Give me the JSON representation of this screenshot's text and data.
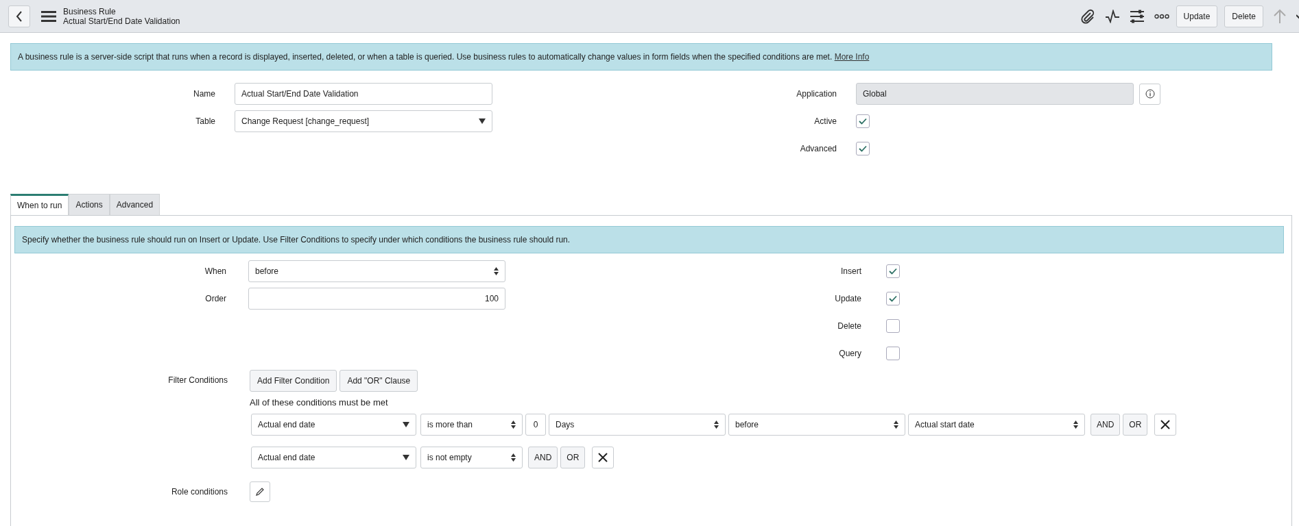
{
  "header": {
    "title": "Business Rule",
    "subtitle": "Actual Start/End Date Validation",
    "buttons": [
      "Update",
      "Delete"
    ]
  },
  "info_banner": {
    "text": "A business rule is a server-side script that runs when a record is displayed, inserted, deleted, or when a table is queried. Use business rules to automatically change values in form fields when the specified conditions are met.",
    "link": "More Info"
  },
  "fields_left": [
    {
      "label": "Name",
      "kind": "text",
      "value": "Actual Start/End Date Validation"
    },
    {
      "label": "Table",
      "kind": "select",
      "value": "Change Request [change_request]"
    }
  ],
  "fields_right": [
    {
      "label": "Application",
      "kind": "readonly",
      "value": "Global"
    },
    {
      "label": "Active",
      "kind": "checkbox",
      "checked": true
    },
    {
      "label": "Advanced",
      "kind": "checkbox",
      "checked": true
    }
  ],
  "tabs": [
    {
      "label": "When to run",
      "selected": true
    },
    {
      "label": "Actions",
      "selected": false
    },
    {
      "label": "Advanced",
      "selected": false
    }
  ],
  "tab_banner": "Specify whether the business rule should run on Insert or Update. Use Filter Conditions to specify under which conditions the business rule should run.",
  "when_fields": [
    {
      "label": "When",
      "kind": "select",
      "value": "before"
    },
    {
      "label": "Order",
      "kind": "number",
      "value": "100"
    }
  ],
  "operations": [
    {
      "label": "Insert",
      "checked": true
    },
    {
      "label": "Update",
      "checked": true
    },
    {
      "label": "Delete",
      "checked": false
    },
    {
      "label": "Query",
      "checked": false
    }
  ],
  "filter": {
    "label": "Filter Conditions",
    "buttons": [
      "Add Filter Condition",
      "Add \"OR\" Clause"
    ],
    "summary": "All of these conditions must be met",
    "conditions": [
      {
        "parts": [
          {
            "kind": "field",
            "value": "Actual end date"
          },
          {
            "kind": "operator",
            "value": "is more than"
          },
          {
            "kind": "number",
            "value": "0"
          },
          {
            "kind": "choice",
            "value": "Days"
          },
          {
            "kind": "choice",
            "value": "before"
          },
          {
            "kind": "choice",
            "value": "Actual start date"
          },
          {
            "kind": "button",
            "value": "AND"
          },
          {
            "kind": "button",
            "value": "OR"
          },
          {
            "kind": "remove"
          }
        ]
      },
      {
        "parts": [
          {
            "kind": "field",
            "value": "Actual end date"
          },
          {
            "kind": "operator",
            "value": "is not empty"
          },
          {
            "kind": "button",
            "value": "AND"
          },
          {
            "kind": "button",
            "value": "OR"
          },
          {
            "kind": "remove"
          }
        ]
      }
    ]
  },
  "role": {
    "label": "Role conditions"
  }
}
